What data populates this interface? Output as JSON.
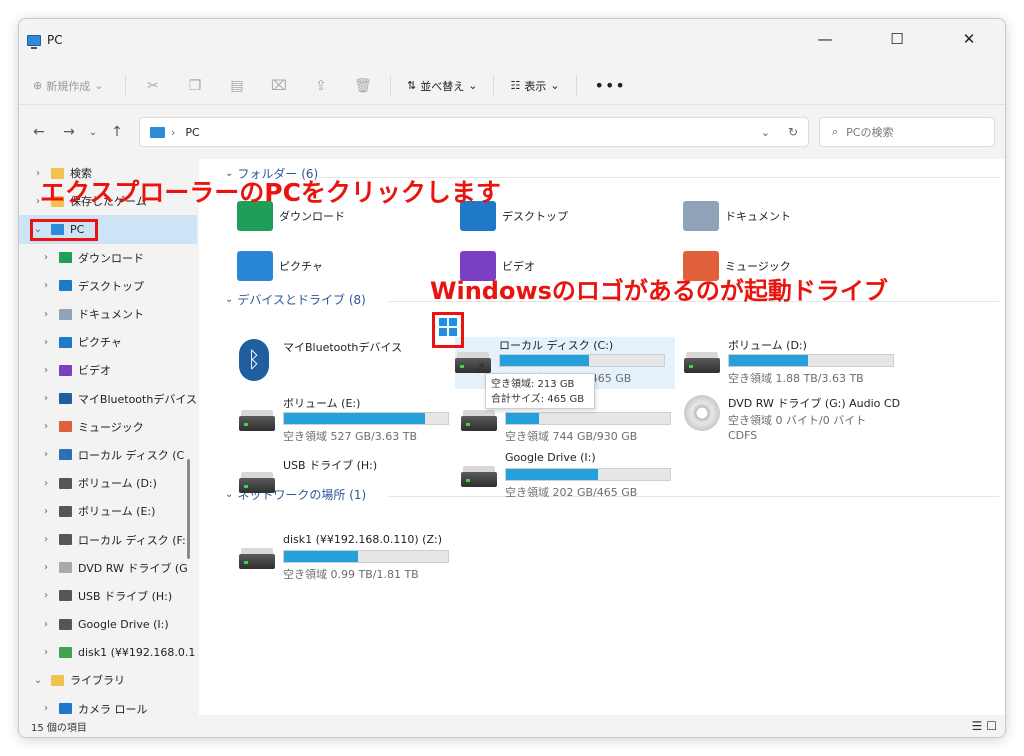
{
  "window": {
    "title": "PC",
    "controls": [
      "—",
      "☐",
      "✕"
    ]
  },
  "toolbar": {
    "new_label": "新規作成",
    "icons": [
      "cut-icon",
      "copy-icon",
      "paste-icon",
      "rename-icon",
      "share-icon",
      "delete-icon"
    ],
    "sort_label": "並べ替え",
    "view_label": "表示",
    "more_label": "•••"
  },
  "address": {
    "location": "PC",
    "search_placeholder": "PCの検索"
  },
  "sidebar": {
    "items": [
      {
        "label": "検索",
        "exp": "›",
        "icon_color": "#f2c14e"
      },
      {
        "label": "保存したゲーム",
        "exp": "›",
        "icon_color": "#f2c14e"
      },
      {
        "label": "PC",
        "exp": "⌄",
        "icon_color": "#2e8bd8",
        "selected": true
      },
      {
        "label": "ダウンロード",
        "exp": "›",
        "icon_color": "#1f9e5a",
        "indent": 1
      },
      {
        "label": "デスクトップ",
        "exp": "›",
        "icon_color": "#1f78c8",
        "indent": 1
      },
      {
        "label": "ドキュメント",
        "exp": "›",
        "icon_color": "#8fa2b8",
        "indent": 1
      },
      {
        "label": "ピクチャ",
        "exp": "›",
        "icon_color": "#1f78c8",
        "indent": 1
      },
      {
        "label": "ビデオ",
        "exp": "›",
        "icon_color": "#7b3fc4",
        "indent": 1
      },
      {
        "label": "マイBluetoothデバイス",
        "exp": "›",
        "icon_color": "#1f5fa0",
        "indent": 1
      },
      {
        "label": "ミュージック",
        "exp": "›",
        "icon_color": "#e0603b",
        "indent": 1
      },
      {
        "label": "ローカル ディスク (C",
        "exp": "›",
        "icon_color": "#2e6fb8",
        "indent": 1
      },
      {
        "label": "ボリューム (D:)",
        "exp": "›",
        "icon_color": "#555555",
        "indent": 1
      },
      {
        "label": "ボリューム (E:)",
        "exp": "›",
        "icon_color": "#555555",
        "indent": 1
      },
      {
        "label": "ローカル ディスク (F:",
        "exp": "›",
        "icon_color": "#555555",
        "indent": 1
      },
      {
        "label": "DVD RW ドライブ (G",
        "exp": "›",
        "icon_color": "#aaaaaa",
        "indent": 1
      },
      {
        "label": "USB ドライブ (H:)",
        "exp": "›",
        "icon_color": "#555555",
        "indent": 1
      },
      {
        "label": "Google Drive (I:)",
        "exp": "›",
        "icon_color": "#555555",
        "indent": 1
      },
      {
        "label": "disk1 (¥¥192.168.0.1",
        "exp": "›",
        "icon_color": "#3fa34d",
        "indent": 1
      },
      {
        "label": "ライブラリ",
        "exp": "⌄",
        "icon_color": "#f2c14e"
      },
      {
        "label": "カメラ ロール",
        "exp": "›",
        "icon_color": "#1f78c8",
        "indent": 1
      }
    ]
  },
  "sections": {
    "folders": "フォルダー (6)",
    "devices": "デバイスとドライブ (8)",
    "network": "ネットワークの場所 (1)"
  },
  "folders": [
    {
      "name": "ダウンロード",
      "color": "#1f9e5a"
    },
    {
      "name": "デスクトップ",
      "color": "#1f78c8"
    },
    {
      "name": "ドキュメント",
      "color": "#8fa2b8"
    },
    {
      "name": "ピクチャ",
      "color": "#2a86d6"
    },
    {
      "name": "ビデオ",
      "color": "#7b3fc4"
    },
    {
      "name": "ミュージック",
      "color": "#e0603b"
    }
  ],
  "drives": [
    {
      "name": "マイBluetoothデバイス",
      "type": "bluetooth"
    },
    {
      "name": "ローカル ディスク (C:)",
      "free": "空き領域 213 GB/465 GB",
      "used_fraction": 0.54,
      "type": "hdd",
      "selected": true
    },
    {
      "name": "ボリューム (D:)",
      "free": "空き領域 1.88 TB/3.63 TB",
      "used_fraction": 0.48,
      "type": "hdd"
    },
    {
      "name": "ボリューム (E:)",
      "free": "空き領域 527 GB/3.63 TB",
      "used_fraction": 0.86,
      "type": "hdd"
    },
    {
      "name": "",
      "free": "空き領域 744 GB/930 GB",
      "used_fraction": 0.2,
      "type": "hdd"
    },
    {
      "name": "DVD RW ドライブ (G:) Audio CD",
      "free": "空き領域 0 バイト/0 バイト",
      "extra": "CDFS",
      "type": "dvd"
    },
    {
      "name": "USB ドライブ (H:)",
      "type": "hdd"
    },
    {
      "name": "Google Drive (I:)",
      "free": "空き領域 202 GB/465 GB",
      "used_fraction": 0.56,
      "type": "hdd"
    }
  ],
  "network": [
    {
      "name": "disk1 (¥¥192.168.0.110) (Z:)",
      "free": "空き領域 0.99 TB/1.81 TB",
      "used_fraction": 0.45
    }
  ],
  "tooltip": {
    "line1": "空き領域: 213 GB",
    "line2": "合計サイズ: 465 GB"
  },
  "status": {
    "count": "15 個の項目"
  },
  "annotations": {
    "explorer_pc": "エクスプローラーのPCをクリックします",
    "windows_logo": "Windowsのロゴがあるのが起動ドライブ"
  },
  "colors": {
    "accent": "#26a0da",
    "selection": "#cde3f6",
    "annotation": "#e8140d",
    "section_heading": "#2b579a"
  }
}
